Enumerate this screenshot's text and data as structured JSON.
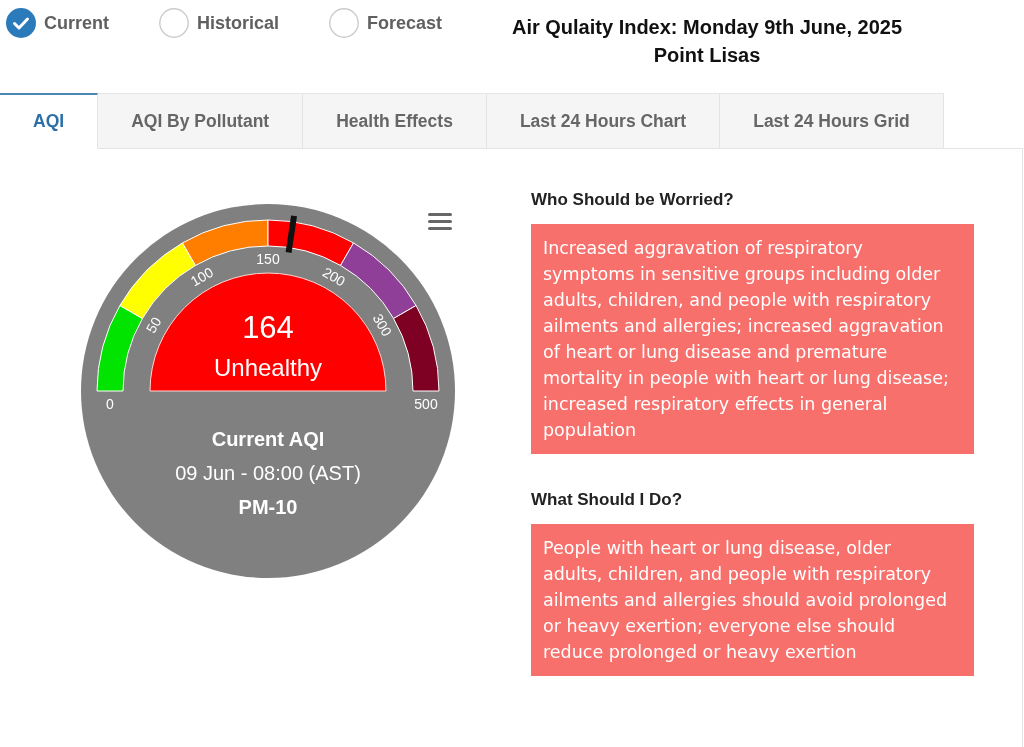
{
  "view_options": [
    {
      "label": "Current",
      "selected": true
    },
    {
      "label": "Historical",
      "selected": false
    },
    {
      "label": "Forecast",
      "selected": false
    }
  ],
  "title": {
    "line_1": "Air Qulaity Index: Monday 9th June, 2025",
    "line_2": "Point Lisas"
  },
  "tabs": [
    {
      "label": "AQI",
      "selected": true
    },
    {
      "label": "AQI By Pollutant",
      "selected": false
    },
    {
      "label": "Health Effects",
      "selected": false
    },
    {
      "label": "Last 24 Hours Chart",
      "selected": false
    },
    {
      "label": "Last 24 Hours Grid",
      "selected": false
    }
  ],
  "gauge": {
    "value": "164",
    "category": "Unhealthy",
    "level": 0.547,
    "scale_labels": [
      "0",
      "50",
      "100",
      "150",
      "200",
      "300",
      "500"
    ],
    "bands": [
      {
        "color": "#00e400"
      },
      {
        "color": "#ffff00"
      },
      {
        "color": "#ff7e00"
      },
      {
        "color": "#ff0000"
      },
      {
        "color": "#8f3f97"
      },
      {
        "color": "#7e0023"
      }
    ],
    "caption": "Current AQI",
    "timestamp": "09 Jun - 08:00 (AST)",
    "pollutant": "PM-10"
  },
  "advice": [
    {
      "heading": "Who Should be Worried?",
      "text": "Increased aggravation of respiratory symptoms in sensitive groups including older adults, children, and people with respiratory ailments and allergies; increased aggravation of heart or lung disease and premature mortality in people with heart or lung disease; increased respiratory effects in general population"
    },
    {
      "heading": "What Should I Do?",
      "text": "People with heart or lung disease, older adults, children, and people with respiratory ailments and allergies should avoid prolonged or heavy exertion; everyone else should reduce prolonged or heavy exertion"
    }
  ]
}
